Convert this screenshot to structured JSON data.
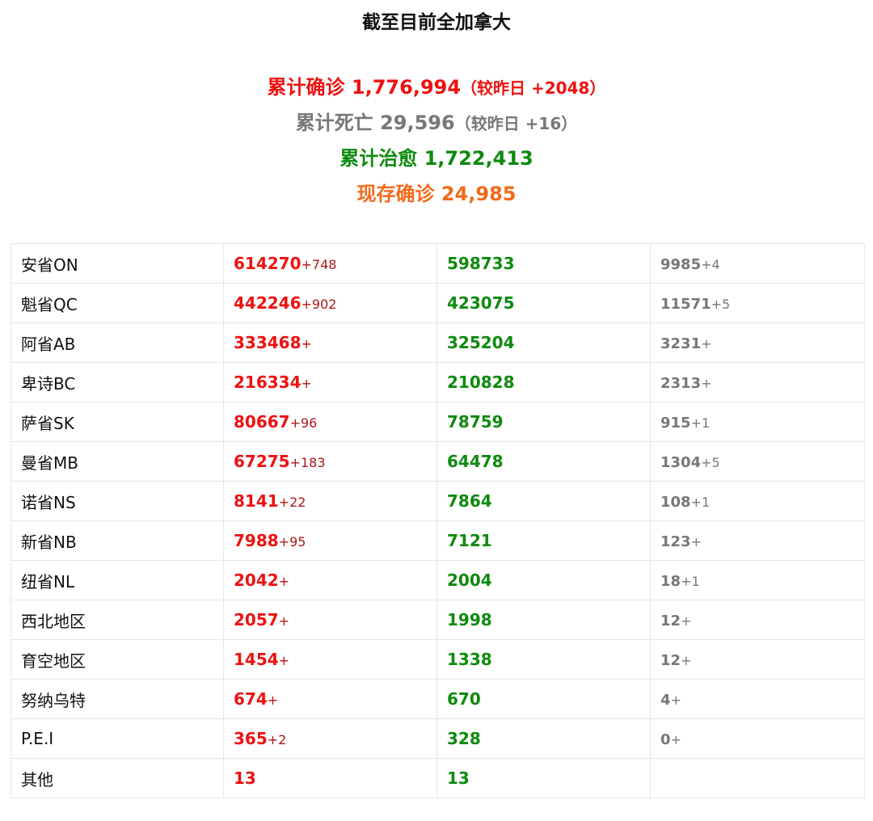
{
  "title": "截至目前全加拿大",
  "summary": {
    "confirmed_label": "累计确诊",
    "confirmed_value": "1,776,994",
    "confirmed_change": "（较昨日 +2048）",
    "deaths_label": "累计死亡",
    "deaths_value": "29,596",
    "deaths_change": "（较昨日 +16）",
    "recovered_label": "累计治愈",
    "recovered_value": "1,722,413",
    "active_label": "现存确诊",
    "active_value": "24,985"
  },
  "colors": {
    "confirmed": "#ee1111",
    "deaths": "#777777",
    "recovered": "#0e8a0e",
    "active": "#f26a1b"
  },
  "provinces": [
    {
      "name": "安省ON",
      "confirmed": "614270",
      "confirmed_delta": "+748",
      "recovered": "598733",
      "deaths": "9985",
      "deaths_delta": "+4"
    },
    {
      "name": "魁省QC",
      "confirmed": "442246",
      "confirmed_delta": "+902",
      "recovered": "423075",
      "deaths": "11571",
      "deaths_delta": "+5"
    },
    {
      "name": "阿省AB",
      "confirmed": "333468",
      "confirmed_delta": "+",
      "recovered": "325204",
      "deaths": "3231",
      "deaths_delta": "+"
    },
    {
      "name": "卑诗BC",
      "confirmed": "216334",
      "confirmed_delta": "+",
      "recovered": "210828",
      "deaths": "2313",
      "deaths_delta": "+"
    },
    {
      "name": "萨省SK",
      "confirmed": "80667",
      "confirmed_delta": "+96",
      "recovered": "78759",
      "deaths": "915",
      "deaths_delta": "+1"
    },
    {
      "name": "曼省MB",
      "confirmed": "67275",
      "confirmed_delta": "+183",
      "recovered": "64478",
      "deaths": "1304",
      "deaths_delta": "+5"
    },
    {
      "name": "诺省NS",
      "confirmed": "8141",
      "confirmed_delta": "+22",
      "recovered": "7864",
      "deaths": "108",
      "deaths_delta": "+1"
    },
    {
      "name": "新省NB",
      "confirmed": "7988",
      "confirmed_delta": "+95",
      "recovered": "7121",
      "deaths": "123",
      "deaths_delta": "+"
    },
    {
      "name": "纽省NL",
      "confirmed": "2042",
      "confirmed_delta": "+",
      "recovered": "2004",
      "deaths": "18",
      "deaths_delta": "+1"
    },
    {
      "name": "西北地区",
      "confirmed": "2057",
      "confirmed_delta": "+",
      "recovered": "1998",
      "deaths": "12",
      "deaths_delta": "+"
    },
    {
      "name": "育空地区",
      "confirmed": "1454",
      "confirmed_delta": "+",
      "recovered": "1338",
      "deaths": "12",
      "deaths_delta": "+"
    },
    {
      "name": "努纳乌特",
      "confirmed": "674",
      "confirmed_delta": "+",
      "recovered": "670",
      "deaths": "4",
      "deaths_delta": "+"
    },
    {
      "name": "P.E.I",
      "confirmed": "365",
      "confirmed_delta": "+2",
      "recovered": "328",
      "deaths": "0",
      "deaths_delta": "+"
    },
    {
      "name": "其他",
      "confirmed": "13",
      "confirmed_delta": "",
      "recovered": "13",
      "deaths": "",
      "deaths_delta": ""
    }
  ]
}
